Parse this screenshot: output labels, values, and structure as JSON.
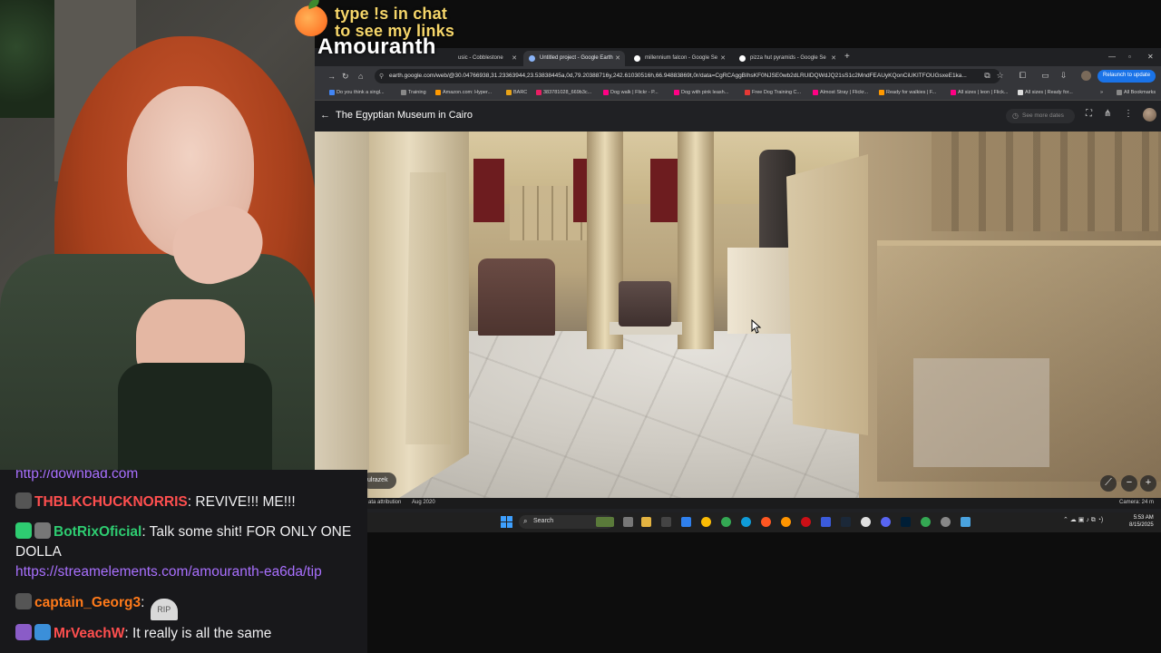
{
  "overlay": {
    "promo_line1": "type !s in chat",
    "promo_line2": "to see my links",
    "streamer_name": "Amouranth"
  },
  "browser": {
    "tabs": [
      {
        "label": "usic - Cobblestone",
        "active": false
      },
      {
        "label": "Untitled project - Google Earth",
        "active": true
      },
      {
        "label": "millennium falcon - Google Se",
        "active": false
      },
      {
        "label": "pizza hut pyramids - Google Se",
        "active": false
      }
    ],
    "url": "earth.google.com/web/@30.04766938,31.23363944,23.53838445a,0d,79.20388716y,242.61030516h,66.94883869t,0r/data=CgRCAggBIhsKF0NJSE0wb2dLRUlDQWdJQ21sS1c2MndFEAUyKQonCiUKITFOUGsxeE1ka...",
    "relaunch_label": "Relaunch to update",
    "bookmarks": [
      {
        "label": "Do you think a singl...",
        "color": "#4285f4"
      },
      {
        "label": "Training",
        "color": "#888888"
      },
      {
        "label": "Amazon.com: Hyper...",
        "color": "#ff9900"
      },
      {
        "label": "BARC",
        "color": "#e8a317"
      },
      {
        "label": "383781028_669b3c...",
        "color": "#e91e63"
      },
      {
        "label": "Dog walk | Flickr - P...",
        "color": "#ff0084"
      },
      {
        "label": "Dog with pink leash...",
        "color": "#ff0084"
      },
      {
        "label": "Free Dog Training C...",
        "color": "#e53935"
      },
      {
        "label": "Almost Stray | Flickr...",
        "color": "#ff0084"
      },
      {
        "label": "Ready for walkies | F...",
        "color": "#ff9900"
      },
      {
        "label": "All sizes | leon | Flick...",
        "color": "#ff0084"
      },
      {
        "label": "All sizes | Ready for...",
        "color": "#dddddd"
      }
    ],
    "all_bookmarks": "All Bookmarks"
  },
  "earth": {
    "place_title": "The Egyptian Museum in Cairo",
    "see_more_dates": "See more dates",
    "street_view_user": "ulrazek",
    "data_attribution": "ata attribution",
    "capture_date": "Aug 2020",
    "camera": "Camera: 24 m",
    "zoom_out": "−",
    "zoom_in": "+"
  },
  "taskbar": {
    "search_placeholder": "Search",
    "time": "5:53 AM",
    "date": "8/15/2025"
  },
  "chat": {
    "messages": [
      {
        "user": "",
        "text": "http://downbad.com",
        "is_link": true
      },
      {
        "user": "THBLKCHUCKNORRIS",
        "user_color": "#ff4f4f",
        "text": "REVIVE!!! ME!!!"
      },
      {
        "user": "BotRixOficial",
        "user_color": "#2ecc71",
        "text": "Talk some shit! FOR ONLY ONE DOLLA",
        "link": "https://streamelements.com/amouranth-ea6da/tip"
      },
      {
        "user": "captain_Georg3",
        "user_color": "#ff7a1a",
        "text": ""
      },
      {
        "user": "MrVeachW",
        "user_color": "#ff4f4f",
        "text": "It really is all the same"
      }
    ],
    "rip_emote": "RIP"
  },
  "colors": {
    "chat_bg": "#18181b",
    "link": "#a970ff",
    "promo_text": "#f6d66a"
  }
}
